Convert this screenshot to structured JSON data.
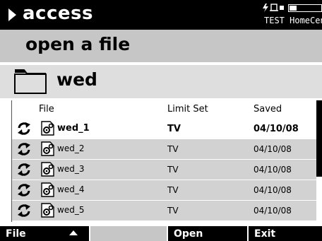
{
  "header": {
    "app_title": "access",
    "device_name": "TEST HomeCen"
  },
  "subtitle": "open a file",
  "folder": {
    "name": "wed"
  },
  "table": {
    "columns": [
      "File",
      "Limit Set",
      "Saved"
    ],
    "rows": [
      {
        "file": "wed_1",
        "limit_set": "TV",
        "saved": "04/10/08",
        "selected": true
      },
      {
        "file": "wed_2",
        "limit_set": "TV",
        "saved": "04/10/08",
        "selected": false
      },
      {
        "file": "wed_3",
        "limit_set": "TV",
        "saved": "04/10/08",
        "selected": false
      },
      {
        "file": "wed_4",
        "limit_set": "TV",
        "saved": "04/10/08",
        "selected": false
      },
      {
        "file": "wed_5",
        "limit_set": "TV",
        "saved": "04/10/08",
        "selected": false
      }
    ]
  },
  "softkeys": {
    "file": "File",
    "open": "Open",
    "exit": "Exit"
  },
  "icons": {
    "status": "plug-icon",
    "battery": "battery-icon",
    "folder": "folder-icon",
    "row_sync": "sync-arrows-icon",
    "row_file": "file-gear-icon"
  }
}
